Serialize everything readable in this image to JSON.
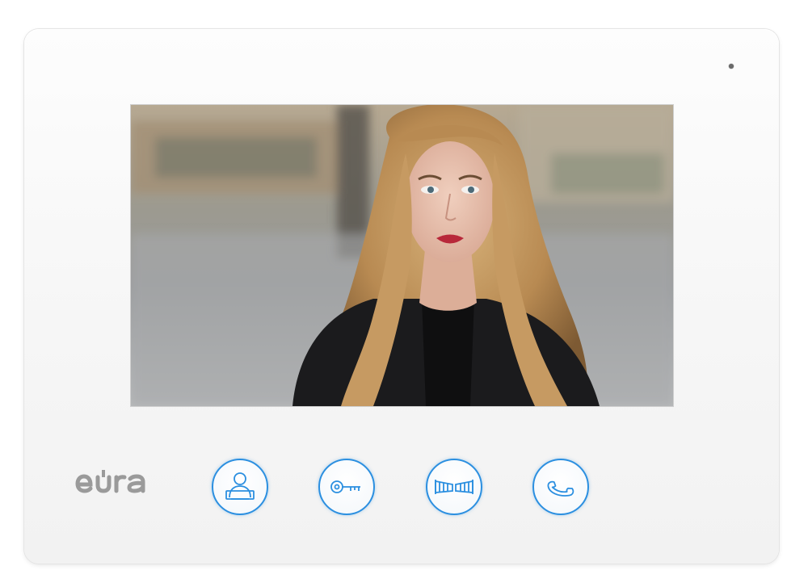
{
  "device": {
    "brand_logo": "eura",
    "colors": {
      "body": "#f6f6f6",
      "accent": "#2b8fe0",
      "logo": "#9a9a9a"
    }
  },
  "screen": {
    "content": "camera-view"
  },
  "buttons": [
    {
      "icon": "monitor-person-icon"
    },
    {
      "icon": "key-icon"
    },
    {
      "icon": "gate-icon"
    },
    {
      "icon": "handset-icon"
    }
  ]
}
